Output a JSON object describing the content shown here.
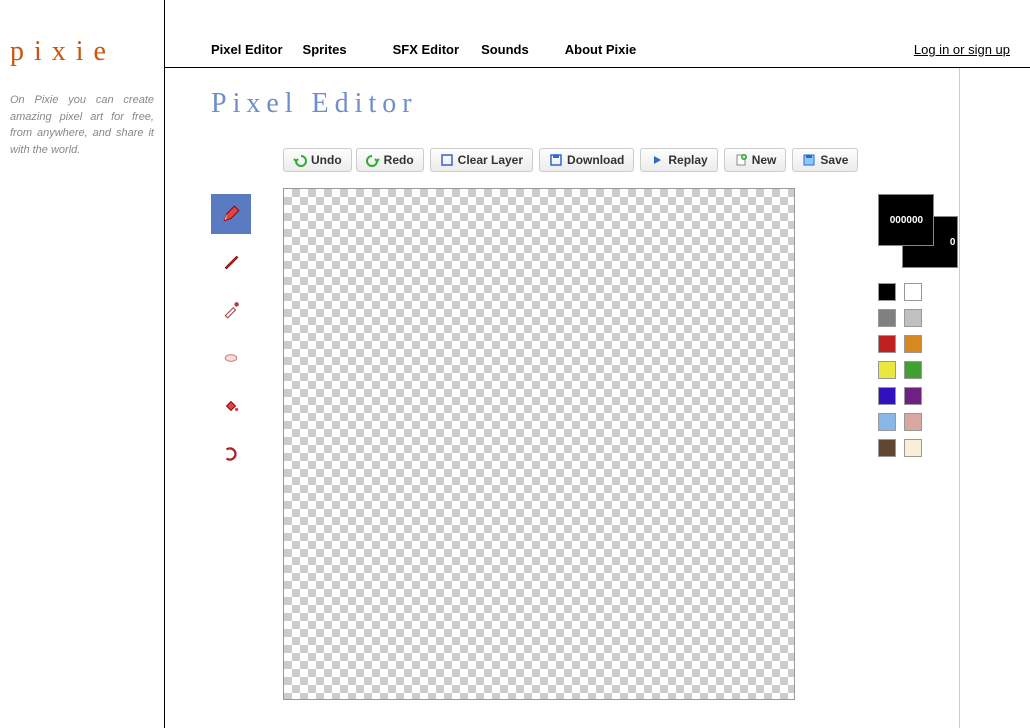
{
  "brand": "pixie",
  "tagline": "On Pixie you can create amazing pixel art for free, from anywhere, and share it with the world.",
  "nav": {
    "pixel_editor": "Pixel Editor",
    "sprites": "Sprites",
    "sfx_editor": "SFX Editor",
    "sounds": "Sounds",
    "about": "About Pixie"
  },
  "login_link": "Log in or sign up",
  "page_title": "Pixel Editor",
  "toolbar": {
    "undo": "Undo",
    "redo": "Redo",
    "clear_layer": "Clear Layer",
    "download": "Download",
    "replay": "Replay",
    "new": "New",
    "save": "Save"
  },
  "tools": [
    {
      "name": "pencil",
      "active": true
    },
    {
      "name": "brush",
      "active": false
    },
    {
      "name": "dropper",
      "active": false
    },
    {
      "name": "eraser",
      "active": false
    },
    {
      "name": "fill",
      "active": false
    },
    {
      "name": "select",
      "active": false
    }
  ],
  "current_color": "000000",
  "palette": [
    [
      "#000000",
      "#ffffff"
    ],
    [
      "#808080",
      "#c0c0c0"
    ],
    [
      "#c02020",
      "#d88820"
    ],
    [
      "#e8e840",
      "#40a030"
    ],
    [
      "#3010c0",
      "#702080"
    ],
    [
      "#88b8e8",
      "#d8a8a0"
    ],
    [
      "#604830",
      "#f8f0d8"
    ]
  ]
}
